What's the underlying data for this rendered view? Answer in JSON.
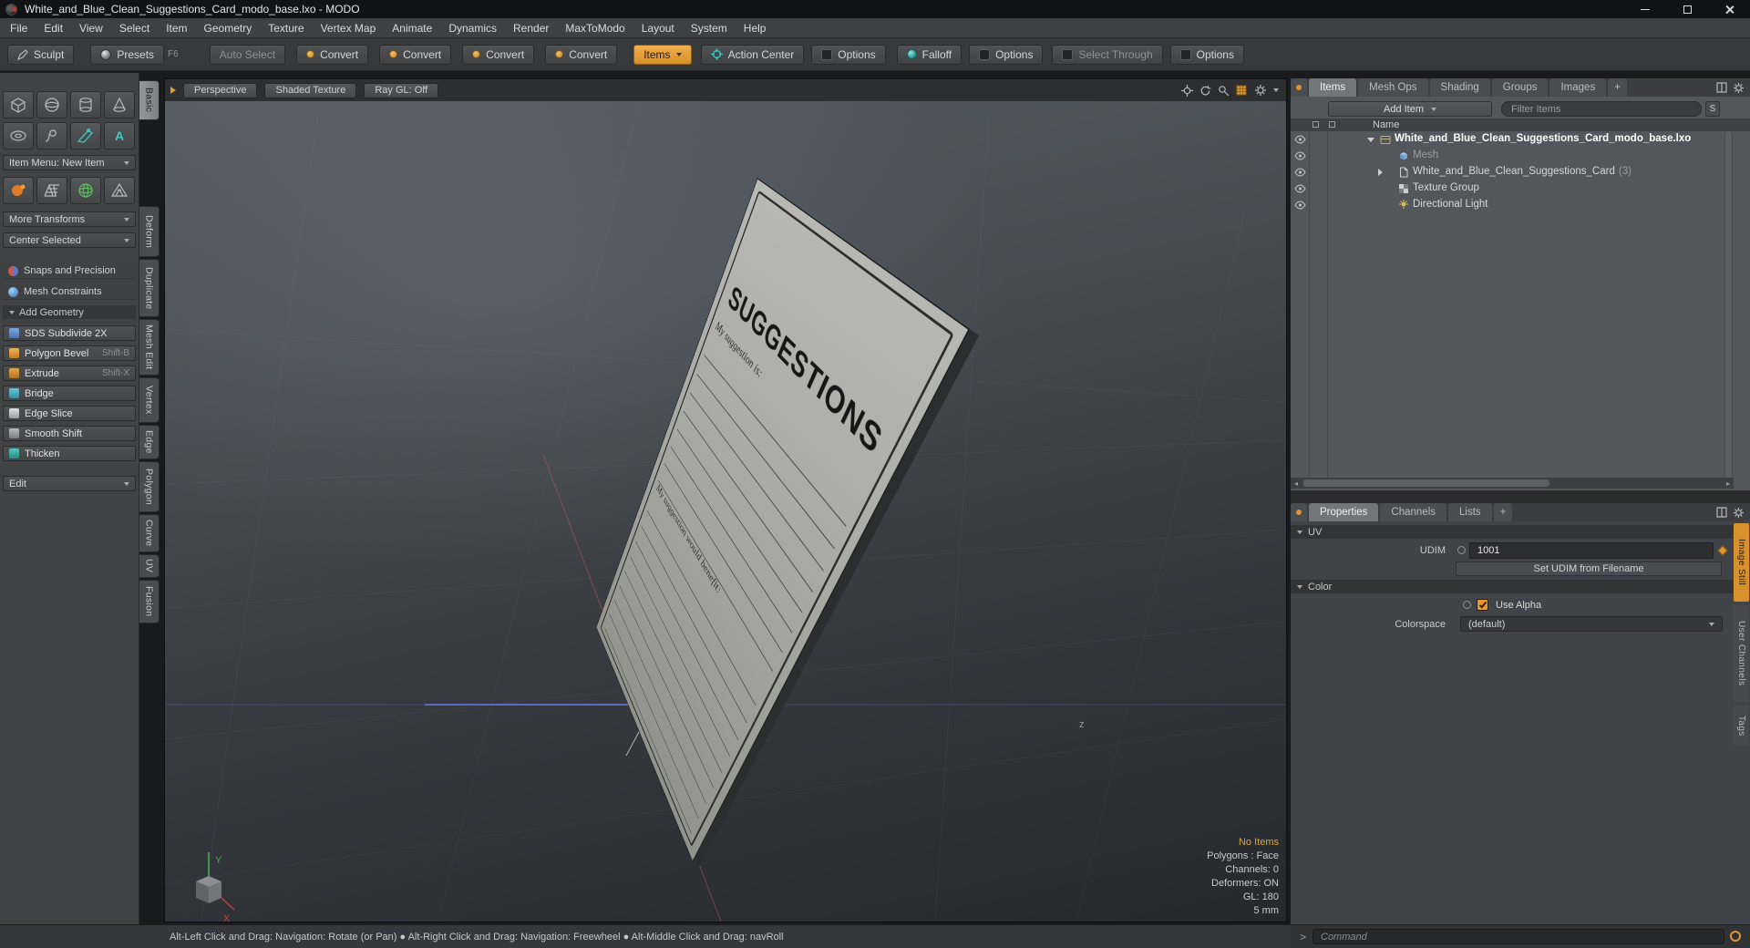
{
  "titlebar": {
    "title": "White_and_Blue_Clean_Suggestions_Card_modo_base.lxo - MODO"
  },
  "menubar": {
    "items": [
      "File",
      "Edit",
      "View",
      "Select",
      "Item",
      "Geometry",
      "Texture",
      "Vertex Map",
      "Animate",
      "Dynamics",
      "Render",
      "MaxToModo",
      "Layout",
      "System",
      "Help"
    ]
  },
  "toolbar": {
    "sculpt": "Sculpt",
    "presets": "Presets",
    "presets_shortcut": "F6",
    "auto_select": "Auto Select",
    "convert": "Convert",
    "items": "Items",
    "action_center": "Action Center",
    "options": "Options",
    "falloff": "Falloff",
    "select_through": "Select Through"
  },
  "tool_tabs": [
    "Basic",
    "Deform",
    "Duplicate",
    "Mesh Edit",
    "Vertex",
    "Edge",
    "Polygon",
    "Curve",
    "UV",
    "Fusion"
  ],
  "toolbox": {
    "item_menu_label": "Item Menu: New Item",
    "more_transforms": "More Transforms",
    "center_selected": "Center Selected",
    "snaps_precision": "Snaps and Precision",
    "mesh_constraints": "Mesh Constraints",
    "add_geometry": "Add Geometry",
    "tools": [
      {
        "label": "SDS Subdivide 2X",
        "shortcut": ""
      },
      {
        "label": "Polygon Bevel",
        "shortcut": "Shift-B"
      },
      {
        "label": "Extrude",
        "shortcut": "Shift-X"
      },
      {
        "label": "Bridge",
        "shortcut": ""
      },
      {
        "label": "Edge Slice",
        "shortcut": ""
      },
      {
        "label": "Smooth Shift",
        "shortcut": ""
      },
      {
        "label": "Thicken",
        "shortcut": ""
      }
    ],
    "edit_label": "Edit"
  },
  "viewport": {
    "tabs": [
      "Perspective",
      "Shaded Texture",
      "Ray GL: Off"
    ],
    "card": {
      "title": "SUGGESTIONS",
      "field1": "My suggestion is:",
      "field2": "My suggestion would benefit:"
    },
    "axis": {
      "x": "X",
      "y": "Y",
      "z": "z"
    },
    "stats": {
      "highlight": "No Items",
      "lines": [
        "Polygons : Face",
        "Channels: 0",
        "Deformers: ON",
        "GL: 180",
        "5 mm"
      ]
    }
  },
  "items_panel": {
    "tabs": [
      "Items",
      "Mesh Ops",
      "Shading",
      "Groups",
      "Images",
      "+"
    ],
    "add_item_label": "Add Item",
    "filter_placeholder": "Filter Items",
    "search_button": "S",
    "name_header": "Name",
    "rows": [
      {
        "label": "White_and_Blue_Clean_Suggestions_Card_modo_base.lxo"
      },
      {
        "label": "Mesh"
      },
      {
        "label": "White_and_Blue_Clean_Suggestions_Card",
        "suffix": "(3)"
      },
      {
        "label": "Texture Group"
      },
      {
        "label": "Directional Light"
      }
    ]
  },
  "properties_panel": {
    "tabs": [
      "Properties",
      "Channels",
      "Lists",
      "+"
    ],
    "uv_section": "UV",
    "udim_label": "UDIM",
    "udim_value": "1001",
    "set_udim_button": "Set UDIM from Filename",
    "color_section": "Color",
    "use_alpha_label": "Use Alpha",
    "colorspace_label": "Colorspace",
    "colorspace_value": "(default)"
  },
  "side_tabs": [
    "Image Still",
    "User Channels",
    "Tags"
  ],
  "statusbar": {
    "prompt": ">",
    "hint": "Alt-Left Click and Drag: Navigation: Rotate (or Pan)  ●  Alt-Right Click and Drag: Navigation: Freewheel  ●  Alt-Middle Click and Drag: navRoll",
    "command_placeholder": "Command"
  },
  "colors": {
    "accent_orange": "#e2983a",
    "accent_teal": "#35c4bc"
  }
}
